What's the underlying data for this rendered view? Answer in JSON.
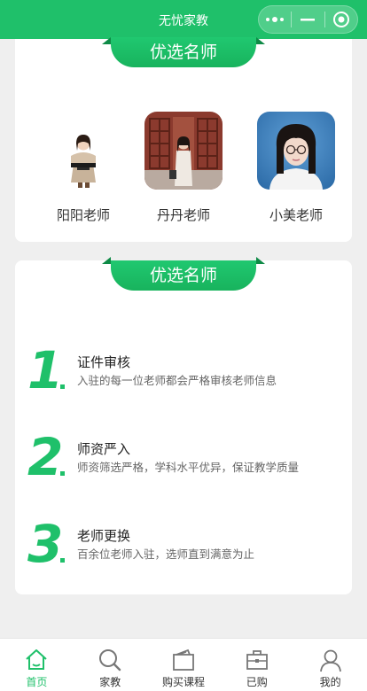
{
  "app": {
    "title": "无忧家教"
  },
  "section1": {
    "title": "优选名师",
    "teachers": [
      {
        "name": "阳阳老师"
      },
      {
        "name": "丹丹老师"
      },
      {
        "name": "小美老师"
      }
    ]
  },
  "section2": {
    "title": "优选名师",
    "steps": [
      {
        "number": "1",
        "title": "证件审核",
        "desc": "入驻的每一位老师都会严格审核老师信息"
      },
      {
        "number": "2",
        "title": "师资严入",
        "desc": "师资筛选严格，学科水平优异，保证教学质量"
      },
      {
        "number": "3",
        "title": "老师更换",
        "desc": "百余位老师入驻，选师直到满意为止"
      }
    ]
  },
  "tabbar": {
    "items": [
      {
        "label": "首页",
        "icon": "home-icon",
        "active": true
      },
      {
        "label": "家教",
        "icon": "search-icon"
      },
      {
        "label": "购买课程",
        "icon": "wallet-icon"
      },
      {
        "label": "已购",
        "icon": "briefcase-icon"
      },
      {
        "label": "我的",
        "icon": "person-icon"
      }
    ]
  },
  "colors": {
    "brand": "#1fc06a",
    "ribbon_dark": "#0e8a46",
    "background": "#efefef"
  }
}
